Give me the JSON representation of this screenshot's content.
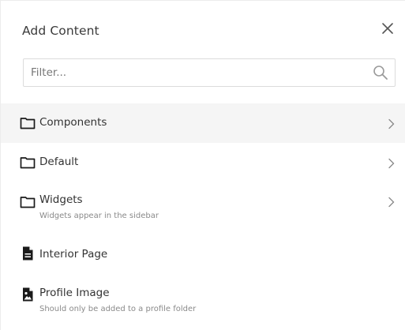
{
  "dialog": {
    "title": "Add Content",
    "close_icon": "close-icon"
  },
  "filter": {
    "placeholder": "Filter...",
    "value": "",
    "icon": "search-icon"
  },
  "items": [
    {
      "label": "Components",
      "description": "",
      "icon": "folder-icon",
      "has_children": true,
      "highlighted": true
    },
    {
      "label": "Default",
      "description": "",
      "icon": "folder-icon",
      "has_children": true,
      "highlighted": false
    },
    {
      "label": "Widgets",
      "description": "Widgets appear in the sidebar",
      "icon": "folder-icon",
      "has_children": true,
      "highlighted": false
    },
    {
      "label": "Interior Page",
      "description": "",
      "icon": "page-icon",
      "has_children": false,
      "highlighted": false
    },
    {
      "label": "Profile Image",
      "description": "Should only be added to a profile folder",
      "icon": "image-file-icon",
      "has_children": false,
      "highlighted": false
    }
  ],
  "colors": {
    "highlight_bg": "#f5f5f5",
    "text": "#333333",
    "muted": "#8a8a8a",
    "border": "#dcdcdc"
  }
}
